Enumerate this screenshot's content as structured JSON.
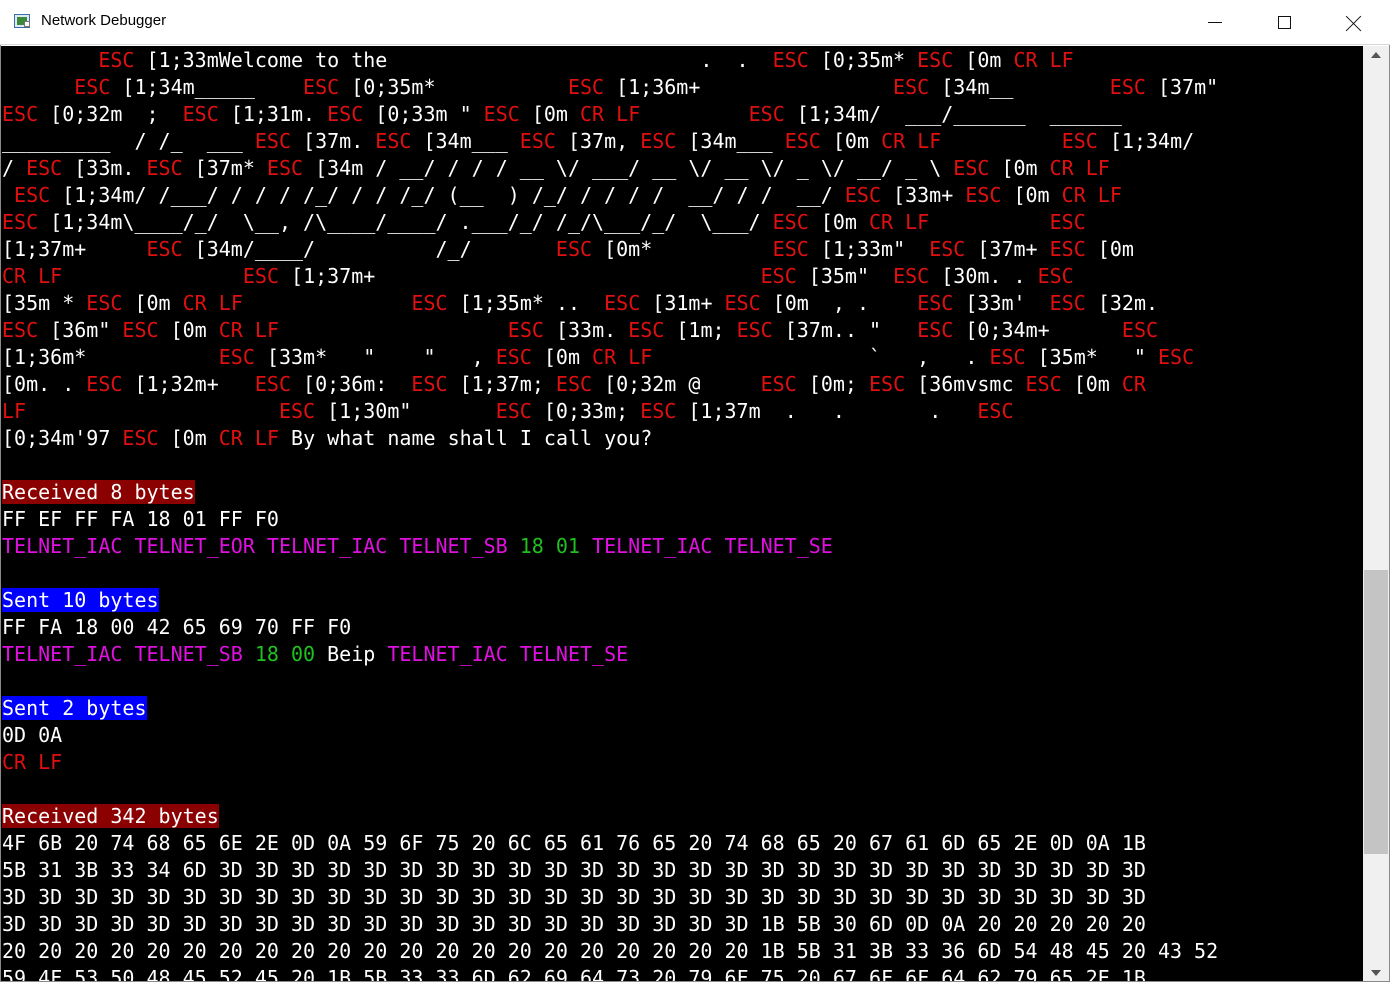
{
  "window": {
    "title": "Network Debugger",
    "minimize_label": "minimize",
    "maximize_label": "maximize",
    "close_label": "close"
  },
  "colors": {
    "console_bg": "#000000",
    "hex_text": "#ffffff",
    "control_code": "#e01010",
    "telnet_command": "#e010e0",
    "numeric_value": "#20c020",
    "received_header_bg": "#8b0000",
    "sent_header_bg": "#0000ff"
  },
  "console": {
    "lines": [
      [
        [
          "c",
          "        ESC"
        ],
        [
          "t",
          " [1;33mWelcome to the                          .  .  "
        ],
        [
          "c",
          "ESC"
        ],
        [
          "t",
          " [0;35m* "
        ],
        [
          "c",
          "ESC"
        ],
        [
          "t",
          " [0m "
        ],
        [
          "c",
          "CR"
        ],
        [
          "t",
          " "
        ],
        [
          "c",
          "LF"
        ]
      ],
      [
        [
          "c",
          "      ESC"
        ],
        [
          "t",
          " [1;34m_____    "
        ],
        [
          "c",
          "ESC"
        ],
        [
          "t",
          " [0;35m*           "
        ],
        [
          "c",
          "ESC"
        ],
        [
          "t",
          " [1;36m+                "
        ],
        [
          "c",
          "ESC"
        ],
        [
          "t",
          " [34m__        "
        ],
        [
          "c",
          "ESC"
        ],
        [
          "t",
          " [37m\""
        ]
      ],
      [
        [
          "c",
          "ESC"
        ],
        [
          "t",
          " [0;32m  ;  "
        ],
        [
          "c",
          "ESC"
        ],
        [
          "t",
          " [1;31m. "
        ],
        [
          "c",
          "ESC"
        ],
        [
          "t",
          " [0;33m \" "
        ],
        [
          "c",
          "ESC"
        ],
        [
          "t",
          " [0m "
        ],
        [
          "c",
          "CR"
        ],
        [
          "t",
          " "
        ],
        [
          "c",
          "LF"
        ],
        [
          "t",
          "         "
        ],
        [
          "c",
          "ESC"
        ],
        [
          "t",
          " [1;34m/  ___/______  ______"
        ]
      ],
      [
        [
          "t",
          "_________  / /_  ___ "
        ],
        [
          "c",
          "ESC"
        ],
        [
          "t",
          " [37m. "
        ],
        [
          "c",
          "ESC"
        ],
        [
          "t",
          " [34m___ "
        ],
        [
          "c",
          "ESC"
        ],
        [
          "t",
          " [37m, "
        ],
        [
          "c",
          "ESC"
        ],
        [
          "t",
          " [34m___ "
        ],
        [
          "c",
          "ESC"
        ],
        [
          "t",
          " [0m "
        ],
        [
          "c",
          "CR"
        ],
        [
          "t",
          " "
        ],
        [
          "c",
          "LF"
        ],
        [
          "t",
          "          "
        ],
        [
          "c",
          "ESC"
        ],
        [
          "t",
          " [1;34m/"
        ]
      ],
      [
        [
          "t",
          "/ "
        ],
        [
          "c",
          "ESC"
        ],
        [
          "t",
          " [33m. "
        ],
        [
          "c",
          "ESC"
        ],
        [
          "t",
          " [37m* "
        ],
        [
          "c",
          "ESC"
        ],
        [
          "t",
          " [34m / __/ / / / __ \\/ ___/ __ \\/ __ \\/ _ \\/ __/ _ \\ "
        ],
        [
          "c",
          "ESC"
        ],
        [
          "t",
          " [0m "
        ],
        [
          "c",
          "CR"
        ],
        [
          "t",
          " "
        ],
        [
          "c",
          "LF"
        ]
      ],
      [
        [
          "t",
          " "
        ],
        [
          "c",
          "ESC"
        ],
        [
          "t",
          " [1;34m/ /___/ / / / /_/ / / /_/ (__  ) /_/ / / / /  __/ / /  __/ "
        ],
        [
          "c",
          "ESC"
        ],
        [
          "t",
          " [33m+ "
        ],
        [
          "c",
          "ESC"
        ],
        [
          "t",
          " [0m "
        ],
        [
          "c",
          "CR"
        ],
        [
          "t",
          " "
        ],
        [
          "c",
          "LF"
        ]
      ],
      [
        [
          "c",
          "ESC"
        ],
        [
          "t",
          " [1;34m\\____/_/  \\__, /\\____/____/ .___/_/ /_/\\___/_/  \\___/ "
        ],
        [
          "c",
          "ESC"
        ],
        [
          "t",
          " [0m "
        ],
        [
          "c",
          "CR"
        ],
        [
          "t",
          " "
        ],
        [
          "c",
          "LF"
        ],
        [
          "t",
          "          "
        ],
        [
          "c",
          "ESC"
        ]
      ],
      [
        [
          "t",
          "[1;37m+     "
        ],
        [
          "c",
          "ESC"
        ],
        [
          "t",
          " [34m/____/          /_/       "
        ],
        [
          "c",
          "ESC"
        ],
        [
          "t",
          " [0m*          "
        ],
        [
          "c",
          "ESC"
        ],
        [
          "t",
          " [1;33m\"  "
        ],
        [
          "c",
          "ESC"
        ],
        [
          "t",
          " [37m+ "
        ],
        [
          "c",
          "ESC"
        ],
        [
          "t",
          " [0m"
        ]
      ],
      [
        [
          "c",
          "CR"
        ],
        [
          "t",
          " "
        ],
        [
          "c",
          "LF"
        ],
        [
          "t",
          "               "
        ],
        [
          "c",
          "ESC"
        ],
        [
          "t",
          " [1;37m+                                "
        ],
        [
          "c",
          "ESC"
        ],
        [
          "t",
          " [35m\"  "
        ],
        [
          "c",
          "ESC"
        ],
        [
          "t",
          " [30m. . "
        ],
        [
          "c",
          "ESC"
        ]
      ],
      [
        [
          "t",
          "[35m * "
        ],
        [
          "c",
          "ESC"
        ],
        [
          "t",
          " [0m "
        ],
        [
          "c",
          "CR"
        ],
        [
          "t",
          " "
        ],
        [
          "c",
          "LF"
        ],
        [
          "t",
          "              "
        ],
        [
          "c",
          "ESC"
        ],
        [
          "t",
          " [1;35m* ..  "
        ],
        [
          "c",
          "ESC"
        ],
        [
          "t",
          " [31m+ "
        ],
        [
          "c",
          "ESC"
        ],
        [
          "t",
          " [0m  , .    "
        ],
        [
          "c",
          "ESC"
        ],
        [
          "t",
          " [33m'  "
        ],
        [
          "c",
          "ESC"
        ],
        [
          "t",
          " [32m."
        ]
      ],
      [
        [
          "c",
          "ESC"
        ],
        [
          "t",
          " [36m\" "
        ],
        [
          "c",
          "ESC"
        ],
        [
          "t",
          " [0m "
        ],
        [
          "c",
          "CR"
        ],
        [
          "t",
          " "
        ],
        [
          "c",
          "LF"
        ],
        [
          "t",
          "                   "
        ],
        [
          "c",
          "ESC"
        ],
        [
          "t",
          " [33m. "
        ],
        [
          "c",
          "ESC"
        ],
        [
          "t",
          " [1m; "
        ],
        [
          "c",
          "ESC"
        ],
        [
          "t",
          " [37m.. \"   "
        ],
        [
          "c",
          "ESC"
        ],
        [
          "t",
          " [0;34m+      "
        ],
        [
          "c",
          "ESC"
        ]
      ],
      [
        [
          "t",
          "[1;36m*           "
        ],
        [
          "c",
          "ESC"
        ],
        [
          "t",
          " [33m*   \"    \"   , "
        ],
        [
          "c",
          "ESC"
        ],
        [
          "t",
          " [0m "
        ],
        [
          "c",
          "CR"
        ],
        [
          "t",
          " "
        ],
        [
          "c",
          "LF"
        ],
        [
          "t",
          "                  `   ,   . "
        ],
        [
          "c",
          "ESC"
        ],
        [
          "t",
          " [35m*   \" "
        ],
        [
          "c",
          "ESC"
        ]
      ],
      [
        [
          "t",
          "[0m. . "
        ],
        [
          "c",
          "ESC"
        ],
        [
          "t",
          " [1;32m+   "
        ],
        [
          "c",
          "ESC"
        ],
        [
          "t",
          " [0;36m:  "
        ],
        [
          "c",
          "ESC"
        ],
        [
          "t",
          " [1;37m; "
        ],
        [
          "c",
          "ESC"
        ],
        [
          "t",
          " [0;32m @     "
        ],
        [
          "c",
          "ESC"
        ],
        [
          "t",
          " [0m; "
        ],
        [
          "c",
          "ESC"
        ],
        [
          "t",
          " [36mvsmc "
        ],
        [
          "c",
          "ESC"
        ],
        [
          "t",
          " [0m "
        ],
        [
          "c",
          "CR"
        ]
      ],
      [
        [
          "c",
          "LF"
        ],
        [
          "t",
          "                     "
        ],
        [
          "c",
          "ESC"
        ],
        [
          "t",
          " [1;30m\"       "
        ],
        [
          "c",
          "ESC"
        ],
        [
          "t",
          " [0;33m; "
        ],
        [
          "c",
          "ESC"
        ],
        [
          "t",
          " [1;37m  .   .       .   "
        ],
        [
          "c",
          "ESC"
        ]
      ],
      [
        [
          "t",
          "[0;34m'97 "
        ],
        [
          "c",
          "ESC"
        ],
        [
          "t",
          " [0m "
        ],
        [
          "c",
          "CR"
        ],
        [
          "t",
          " "
        ],
        [
          "c",
          "LF"
        ],
        [
          "t",
          " By what name shall I call you?"
        ]
      ],
      [],
      [
        [
          "hr",
          "Received 8 bytes"
        ]
      ],
      [
        [
          "t",
          "FF EF FF FA 18 01 FF F0"
        ]
      ],
      [
        [
          "p",
          "TELNET_IAC TELNET_EOR TELNET_IAC TELNET_SB "
        ],
        [
          "g",
          "18 01"
        ],
        [
          "p",
          " TELNET_IAC TELNET_SE"
        ]
      ],
      [],
      [
        [
          "hs",
          "Sent 10 bytes"
        ]
      ],
      [
        [
          "t",
          "FF FA 18 00 42 65 69 70 FF F0"
        ]
      ],
      [
        [
          "p",
          "TELNET_IAC TELNET_SB "
        ],
        [
          "g",
          "18 00"
        ],
        [
          "t",
          " Beip "
        ],
        [
          "p",
          "TELNET_IAC TELNET_SE"
        ]
      ],
      [],
      [
        [
          "hs",
          "Sent 2 bytes"
        ]
      ],
      [
        [
          "t",
          "0D 0A"
        ]
      ],
      [
        [
          "c",
          "CR"
        ],
        [
          "t",
          " "
        ],
        [
          "c",
          "LF"
        ]
      ],
      [],
      [
        [
          "hr",
          "Received 342 bytes"
        ]
      ],
      [
        [
          "t",
          "4F 6B 20 74 68 65 6E 2E 0D 0A 59 6F 75 20 6C 65 61 76 65 20 74 68 65 20 67 61 6D 65 2E 0D 0A 1B"
        ]
      ],
      [
        [
          "t",
          "5B 31 3B 33 34 6D 3D 3D 3D 3D 3D 3D 3D 3D 3D 3D 3D 3D 3D 3D 3D 3D 3D 3D 3D 3D 3D 3D 3D 3D 3D 3D"
        ]
      ],
      [
        [
          "t",
          "3D 3D 3D 3D 3D 3D 3D 3D 3D 3D 3D 3D 3D 3D 3D 3D 3D 3D 3D 3D 3D 3D 3D 3D 3D 3D 3D 3D 3D 3D 3D 3D"
        ]
      ],
      [
        [
          "t",
          "3D 3D 3D 3D 3D 3D 3D 3D 3D 3D 3D 3D 3D 3D 3D 3D 3D 3D 3D 3D 3D 1B 5B 30 6D 0D 0A 20 20 20 20 20"
        ]
      ],
      [
        [
          "t",
          "20 20 20 20 20 20 20 20 20 20 20 20 20 20 20 20 20 20 20 20 20 1B 5B 31 3B 33 36 6D 54 48 45 20 43 52"
        ]
      ],
      [
        [
          "t",
          "59 4F 53 50 48 45 52 45 20 1B 5B 33 33 6D 62 69 64 73 20 79 6F 75 20 67 6F 6F 64 62 79 65 2E 1B"
        ]
      ]
    ]
  }
}
